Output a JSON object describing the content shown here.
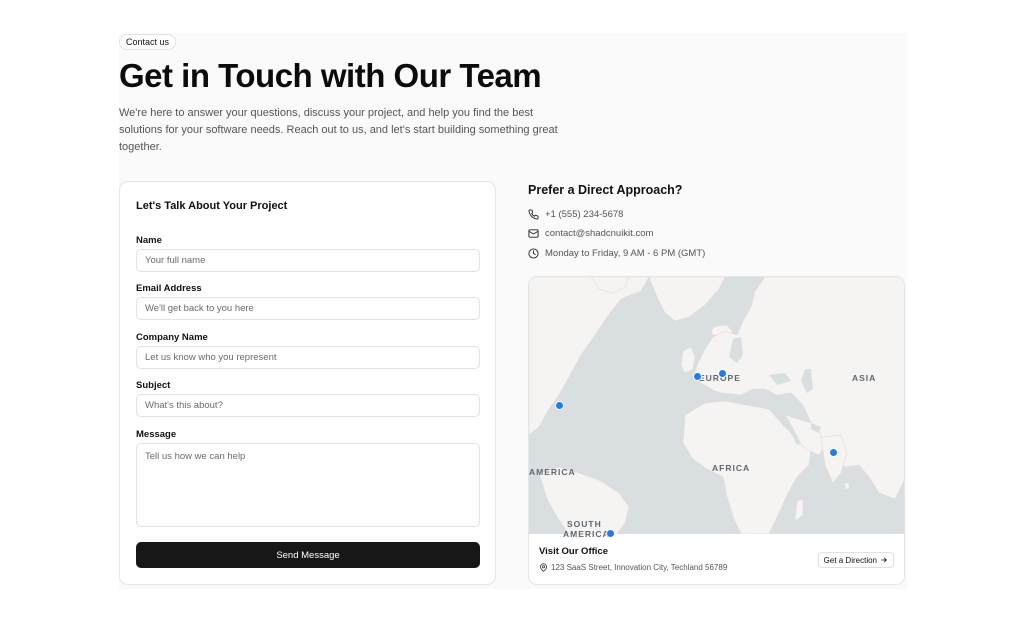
{
  "header": {
    "badge": "Contact us",
    "title": "Get in Touch with Our Team",
    "subtitle": "We're here to answer your questions, discuss your project, and help you find the best solutions for your software needs. Reach out to us, and let's start building something great together."
  },
  "form": {
    "title": "Let's Talk About Your Project",
    "fields": [
      {
        "label": "Name",
        "placeholder": "Your full name",
        "value": ""
      },
      {
        "label": "Email Address",
        "placeholder": "We'll get back to you here",
        "value": ""
      },
      {
        "label": "Company Name",
        "placeholder": "Let us know who you represent",
        "value": ""
      },
      {
        "label": "Subject",
        "placeholder": "What's this about?",
        "value": ""
      },
      {
        "label": "Message",
        "placeholder": "Tell us how we can help",
        "value": ""
      }
    ],
    "submit_label": "Send Message"
  },
  "contact": {
    "title": "Prefer a Direct Approach?",
    "phone": "+1 (555) 234-5678",
    "email": "contact@shadcnuikit.com",
    "hours": "Monday to Friday, 9 AM - 6 PM (GMT)",
    "icons": [
      "phone-icon",
      "mail-icon",
      "clock-icon"
    ]
  },
  "map": {
    "labels": {
      "europe": "EUROPE",
      "asia": "ASIA",
      "africa": "AFRICA",
      "america": "AMERICA",
      "south_america_1": "SOUTH",
      "south_america_2": "AMERICA"
    },
    "marker_color": "#1e7bf0",
    "office_title": "Visit Our Office",
    "office_address": "123 SaaS Street, Innovation City, Techland 56789",
    "direction_label": "Get a Direction"
  },
  "colors": {
    "primary": "#171717",
    "accent": "#1e7bf0"
  }
}
